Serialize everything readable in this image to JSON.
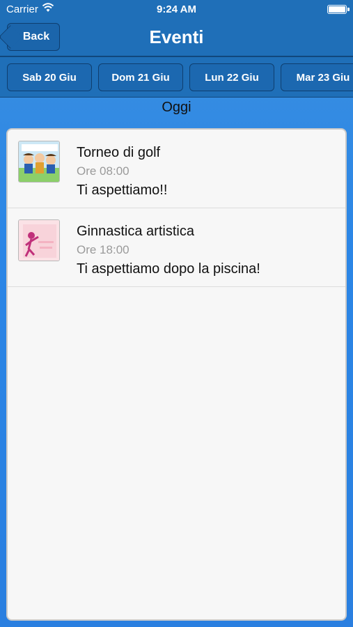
{
  "status_bar": {
    "carrier": "Carrier",
    "time": "9:24 AM"
  },
  "navbar": {
    "back_label": "Back",
    "title": "Eventi"
  },
  "days": [
    "Sab 20 Giu",
    "Dom 21 Giu",
    "Lun 22 Giu",
    "Mar 23 Giu"
  ],
  "section_title": "Oggi",
  "events": [
    {
      "title": "Torneo di golf",
      "time": "Ore 08:00",
      "description": "Ti aspettiamo!!",
      "thumb": "kids-golf-image"
    },
    {
      "title": "Ginnastica artistica",
      "time": "Ore 18:00",
      "description": "Ti aspettiamo dopo la piscina!",
      "thumb": "gymnast-image"
    }
  ],
  "colors": {
    "nav_bg": "#1f6fb8",
    "body_bg": "#2b86e6",
    "button_border": "#0f3e6e"
  }
}
